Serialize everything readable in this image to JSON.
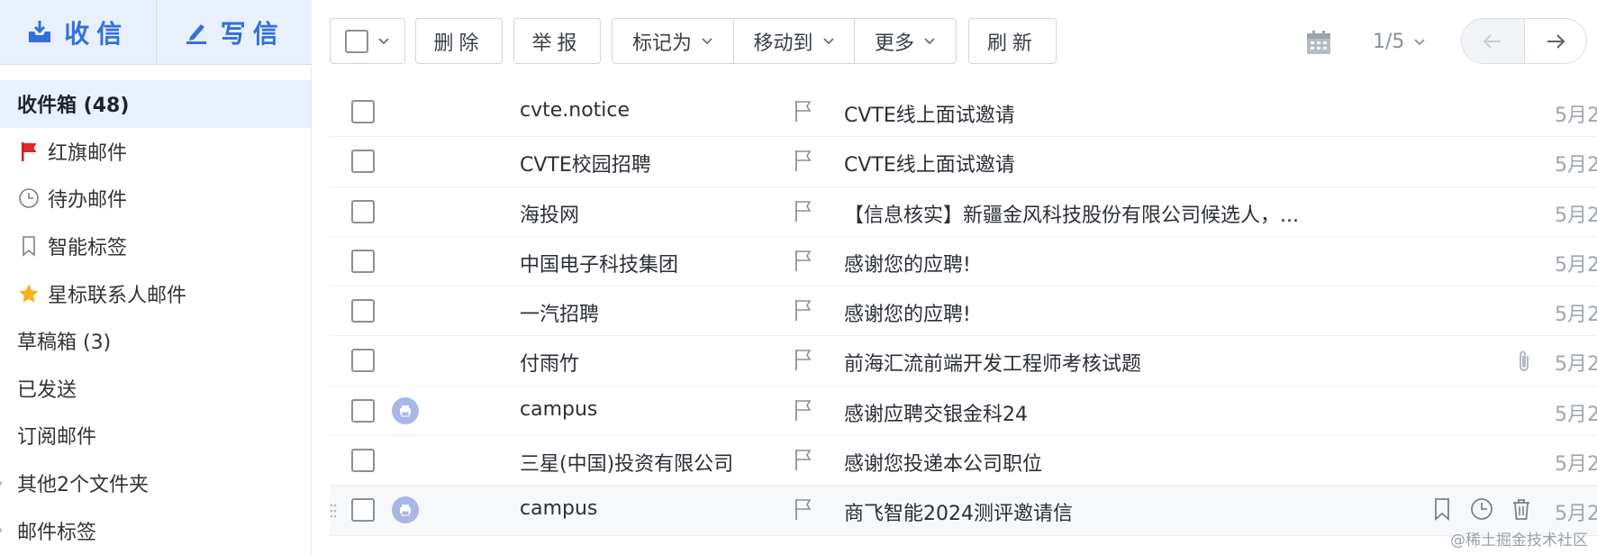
{
  "compose": {
    "receive_label": "收信",
    "write_label": "写信"
  },
  "sidebar": {
    "items": [
      {
        "label": "收件箱 (48)",
        "icon": ""
      },
      {
        "label": "红旗邮件",
        "icon": "red-flag-icon"
      },
      {
        "label": "待办邮件",
        "icon": "clock-icon"
      },
      {
        "label": "智能标签",
        "icon": "bookmark-icon"
      },
      {
        "label": "星标联系人邮件",
        "icon": "star-icon"
      },
      {
        "label": "草稿箱 (3)",
        "icon": ""
      },
      {
        "label": "已发送",
        "icon": ""
      },
      {
        "label": "订阅邮件",
        "icon": ""
      },
      {
        "label": "其他2个文件夹",
        "icon": ""
      },
      {
        "label": "邮件标签",
        "icon": ""
      }
    ]
  },
  "toolbar": {
    "delete_label": "删除",
    "report_label": "举报",
    "mark_as_label": "标记为",
    "move_to_label": "移动到",
    "more_label": "更多",
    "refresh_label": "刷新",
    "page_indicator": "1/5"
  },
  "mails": [
    {
      "sender": "cvte.notice",
      "subject": "CVTE线上面试邀请",
      "date": "5月2",
      "avatar": false,
      "attachment": false,
      "hover": false
    },
    {
      "sender": "CVTE校园招聘",
      "subject": "CVTE线上面试邀请",
      "date": "5月2",
      "avatar": false,
      "attachment": false,
      "hover": false
    },
    {
      "sender": "海投网",
      "subject": "【信息核实】新疆金风科技股份有限公司候选人，...",
      "date": "5月2",
      "avatar": false,
      "attachment": false,
      "hover": false
    },
    {
      "sender": "中国电子科技集团",
      "subject": "感谢您的应聘!",
      "date": "5月2",
      "avatar": false,
      "attachment": false,
      "hover": false
    },
    {
      "sender": "一汽招聘",
      "subject": "感谢您的应聘!",
      "date": "5月2",
      "avatar": false,
      "attachment": false,
      "hover": false
    },
    {
      "sender": "付雨竹",
      "subject": "前海汇流前端开发工程师考核试题",
      "date": "5月2",
      "avatar": false,
      "attachment": true,
      "hover": false
    },
    {
      "sender": "campus",
      "subject": "感谢应聘交银金科24",
      "date": "5月2",
      "avatar": true,
      "attachment": false,
      "hover": false
    },
    {
      "sender": "三星(中国)投资有限公司",
      "subject": "感谢您投递本公司职位",
      "date": "5月2",
      "avatar": false,
      "attachment": false,
      "hover": false
    },
    {
      "sender": "campus",
      "subject": "商飞智能2024测评邀请信",
      "date": "5月2",
      "avatar": true,
      "attachment": false,
      "hover": true
    }
  ],
  "watermark": "@稀土掘金技术社区",
  "colors": {
    "accent": "#3470d6",
    "active_bg": "#e8f0fb",
    "flag_red": "#e02b2b",
    "star": "#f6b11b"
  }
}
